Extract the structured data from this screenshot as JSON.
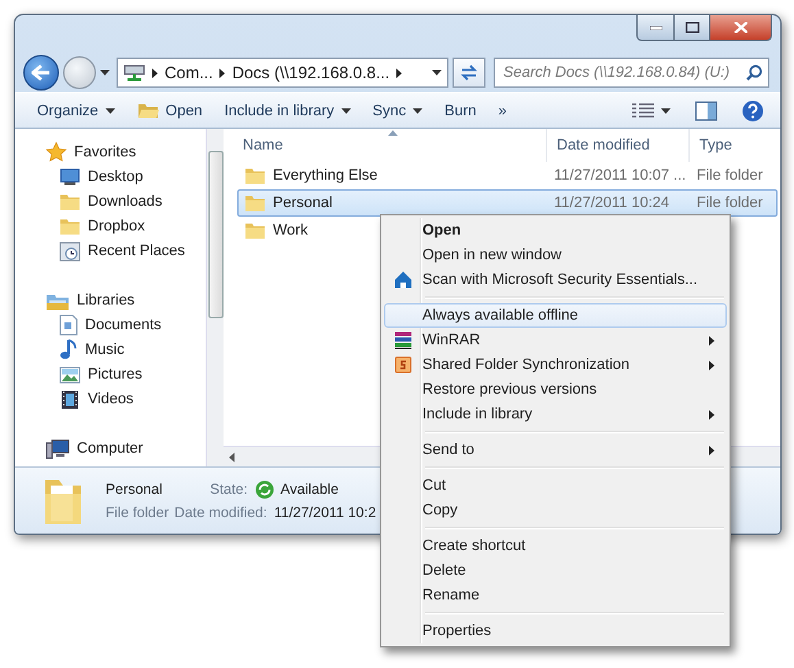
{
  "address_bar": {
    "crumbs": [
      "Com...",
      "Docs (\\\\192.168.0.8..."
    ]
  },
  "search": {
    "placeholder": "Search Docs (\\\\192.168.0.84) (U:)"
  },
  "toolbar": [
    {
      "label": "Organize",
      "dropdown": true
    },
    {
      "label": "Open",
      "dropdown": false
    },
    {
      "label": "Include in library",
      "dropdown": true
    },
    {
      "label": "Sync",
      "dropdown": true
    },
    {
      "label": "Burn",
      "dropdown": false
    },
    {
      "label": "»",
      "dropdown": false
    }
  ],
  "navigation": [
    {
      "label": "Favorites",
      "children": [
        {
          "label": "Desktop"
        },
        {
          "label": "Downloads"
        },
        {
          "label": "Dropbox"
        },
        {
          "label": "Recent Places"
        }
      ]
    },
    {
      "label": "Libraries",
      "children": [
        {
          "label": "Documents"
        },
        {
          "label": "Music"
        },
        {
          "label": "Pictures"
        },
        {
          "label": "Videos"
        }
      ]
    },
    {
      "label": "Computer"
    }
  ],
  "file_list": {
    "columns": [
      "Name",
      "Date modified",
      "Type"
    ],
    "rows": [
      {
        "name": "Everything Else",
        "date": "11/27/2011 10:07 ...",
        "type": "File folder",
        "selected": false
      },
      {
        "name": "Personal",
        "date": "11/27/2011 10:24",
        "type": "File folder",
        "selected": true
      },
      {
        "name": "Work",
        "selected": false
      }
    ]
  },
  "details": {
    "name": "Personal",
    "type": "File folder",
    "state_label": "State:",
    "state": "Available",
    "date_label": "Date modified:",
    "date": "11/27/2011 10:2"
  },
  "context_menu": [
    {
      "kind": "default",
      "label": "Open",
      "selected": false,
      "submenu": false
    },
    {
      "kind": "item",
      "label": "Open in new window",
      "selected": false,
      "submenu": false
    },
    {
      "kind": "item",
      "label": "Scan with Microsoft Security Essentials...",
      "selected": false,
      "submenu": false
    },
    {
      "kind": "separator"
    },
    {
      "kind": "item",
      "label": "Always available offline",
      "selected": true,
      "submenu": false
    },
    {
      "kind": "item",
      "label": "WinRAR",
      "selected": false,
      "submenu": true
    },
    {
      "kind": "item",
      "label": "Shared Folder Synchronization",
      "selected": false,
      "submenu": true
    },
    {
      "kind": "item",
      "label": "Restore previous versions",
      "selected": false,
      "submenu": false
    },
    {
      "kind": "item",
      "label": "Include in library",
      "selected": false,
      "submenu": true
    },
    {
      "kind": "separator"
    },
    {
      "kind": "item",
      "label": "Send to",
      "selected": false,
      "submenu": true
    },
    {
      "kind": "separator"
    },
    {
      "kind": "item",
      "label": "Cut",
      "selected": false,
      "submenu": false
    },
    {
      "kind": "item",
      "label": "Copy",
      "selected": false,
      "submenu": false
    },
    {
      "kind": "separator"
    },
    {
      "kind": "item",
      "label": "Create shortcut",
      "selected": false,
      "submenu": false
    },
    {
      "kind": "item",
      "label": "Delete",
      "selected": false,
      "submenu": false
    },
    {
      "kind": "item",
      "label": "Rename",
      "selected": false,
      "submenu": false
    },
    {
      "kind": "separator"
    },
    {
      "kind": "item",
      "label": "Properties",
      "selected": false,
      "submenu": false
    }
  ]
}
